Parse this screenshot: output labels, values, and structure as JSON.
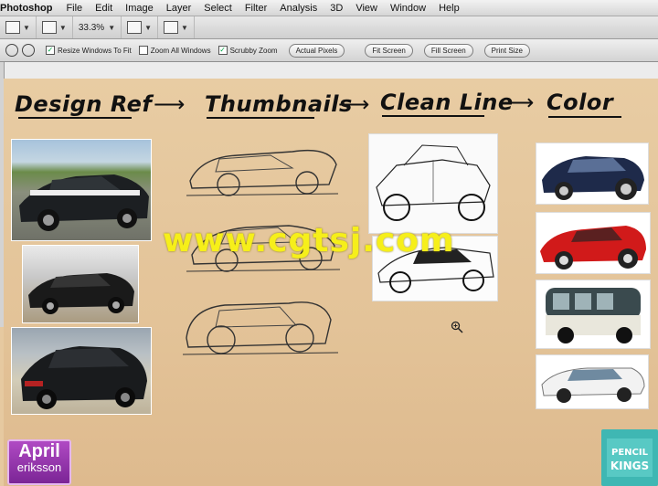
{
  "menubar": {
    "app_name": "Photoshop",
    "items": [
      "File",
      "Edit",
      "Image",
      "Layer",
      "Select",
      "Filter",
      "Analysis",
      "3D",
      "View",
      "Window",
      "Help"
    ]
  },
  "optbar1": {
    "zoom_level": "33.3%"
  },
  "optbar2": {
    "checkboxes": [
      {
        "label": "Resize Windows To Fit",
        "checked": true
      },
      {
        "label": "Zoom All Windows",
        "checked": false
      },
      {
        "label": "Scrubby Zoom",
        "checked": true
      }
    ],
    "buttons": [
      "Actual Pixels",
      "Fit Screen",
      "Fill Screen",
      "Print Size"
    ]
  },
  "canvas": {
    "headings": {
      "design_ref": "Design Ref",
      "thumbnails": "Thumbnails",
      "clean_line": "Clean Line",
      "color": "Color"
    },
    "watermark": "www.cgtsj.com"
  },
  "badge": {
    "line1": "April",
    "line2": "eriksson"
  },
  "logo": {
    "line1": "PENCIL",
    "line2": "KINGS"
  },
  "icons": [
    "zoom-tool-icon",
    "zoom-cursor-icon",
    "dropdown-arrow-icon",
    "arrow-right-icon"
  ],
  "colors": {
    "canvas": "#e6c9a0",
    "watermark": "#f6ef1a",
    "badge": "#9a3bb3",
    "logo": "#3fb7b3"
  }
}
